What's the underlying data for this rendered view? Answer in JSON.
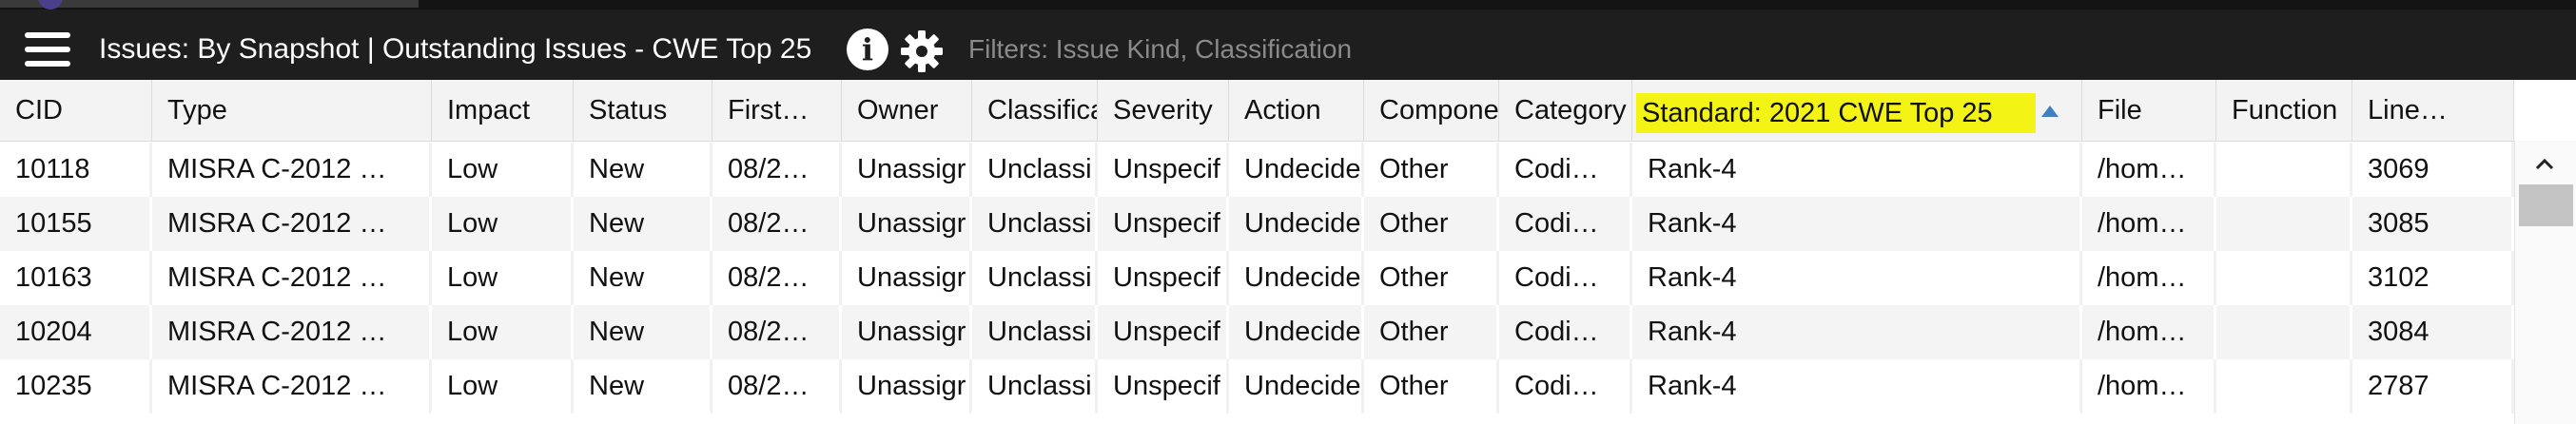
{
  "toolbar": {
    "title": "Issues: By Snapshot | Outstanding Issues - CWE Top 25",
    "info_icon": "i",
    "filters_text": "Filters: Issue Kind, Classification"
  },
  "table": {
    "columns": [
      "CID",
      "Type",
      "Impact",
      "Status",
      "First…",
      "Owner",
      "Classifica",
      "Severity",
      "Action",
      "Compone",
      "Category",
      "Standard: 2021 CWE Top 25",
      "File",
      "Function",
      "Line…"
    ],
    "sorted_column": "Standard: 2021 CWE Top 25",
    "sort_direction": "ascending",
    "rows": [
      [
        "10118",
        "MISRA C-2012 …",
        "Low",
        "New",
        "08/2…",
        "Unassigr",
        "Unclassi",
        "Unspecif",
        "Undecide",
        "Other",
        "Codi…",
        "Rank-4",
        "/hom…",
        "",
        "3069"
      ],
      [
        "10155",
        "MISRA C-2012 …",
        "Low",
        "New",
        "08/2…",
        "Unassigr",
        "Unclassi",
        "Unspecif",
        "Undecide",
        "Other",
        "Codi…",
        "Rank-4",
        "/hom…",
        "",
        "3085"
      ],
      [
        "10163",
        "MISRA C-2012 …",
        "Low",
        "New",
        "08/2…",
        "Unassigr",
        "Unclassi",
        "Unspecif",
        "Undecide",
        "Other",
        "Codi…",
        "Rank-4",
        "/hom…",
        "",
        "3102"
      ],
      [
        "10204",
        "MISRA C-2012 …",
        "Low",
        "New",
        "08/2…",
        "Unassigr",
        "Unclassi",
        "Unspecif",
        "Undecide",
        "Other",
        "Codi…",
        "Rank-4",
        "/hom…",
        "",
        "3084"
      ],
      [
        "10235",
        "MISRA C-2012 …",
        "Low",
        "New",
        "08/2…",
        "Unassigr",
        "Unclassi",
        "Unspecif",
        "Undecide",
        "Other",
        "Codi…",
        "Rank-4",
        "/hom…",
        "",
        "2787"
      ]
    ]
  },
  "colors": {
    "toolbar_bg": "#1e1e1e",
    "sort_highlight": "#f3f316",
    "sort_arrow": "#3f7fc4"
  },
  "icons": [
    "hamburger-menu-icon",
    "info-icon",
    "gear-icon",
    "sort-ascending-icon",
    "chevron-up-icon"
  ]
}
